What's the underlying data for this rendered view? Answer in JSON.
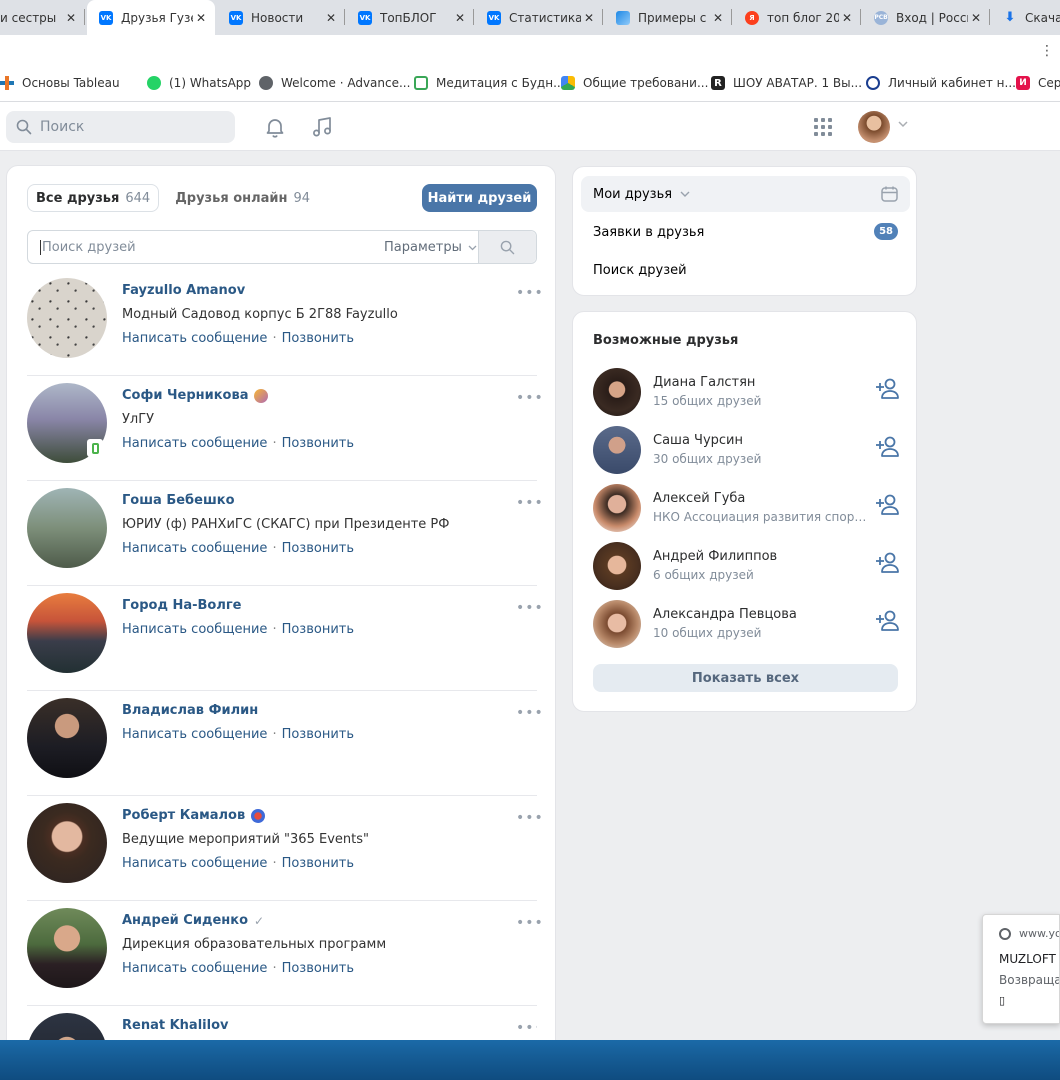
{
  "tabs": [
    {
      "title": "и сестры",
      "favicon": "generic",
      "active": false
    },
    {
      "title": "Друзья Гузе",
      "favicon": "vk",
      "active": true
    },
    {
      "title": "Новости",
      "favicon": "vk",
      "active": false
    },
    {
      "title": "ТопБЛОГ",
      "favicon": "vk",
      "active": false
    },
    {
      "title": "Статистика",
      "favicon": "vk",
      "active": false
    },
    {
      "title": "Примеры с",
      "favicon": "cloud",
      "active": false
    },
    {
      "title": "топ блог 20",
      "favicon": "yandex",
      "active": false
    },
    {
      "title": "Вход | Росси",
      "favicon": "rsv",
      "active": false
    },
    {
      "title": "Скачать",
      "favicon": "download",
      "active": false
    }
  ],
  "tab_close": "✕",
  "bookmarks": [
    {
      "label": "Основы Tableau",
      "icon": "tableau-icon",
      "color": "#e97627"
    },
    {
      "label": "(1) WhatsApp",
      "icon": "whatsapp-icon",
      "color": "#25d366"
    },
    {
      "label": "Welcome · Advance...",
      "icon": "globe-icon",
      "color": "#5f6368"
    },
    {
      "label": "Медитация с Будн...",
      "icon": "house-icon",
      "color": "#3aa757"
    },
    {
      "label": "Общие требовани...",
      "icon": "drive-icon",
      "color": "#fbbc04"
    },
    {
      "label": "ШОУ АВАТАР. 1 Вы...",
      "icon": "r-icon",
      "color": "#222222"
    },
    {
      "label": "Личный кабинет н...",
      "icon": "emblem-icon",
      "color": "#1a3d8f"
    },
    {
      "label": "Сер",
      "icon": "ivi-icon",
      "color": "#e4124b"
    }
  ],
  "header": {
    "search_placeholder": "Поиск",
    "icons": [
      "bell-icon",
      "music-icon",
      "apps-grid-icon"
    ]
  },
  "friends_page": {
    "tabs": [
      {
        "label": "Все друзья",
        "count": "644",
        "selected": true
      },
      {
        "label": "Друзья онлайн",
        "count": "94",
        "selected": false
      }
    ],
    "find_button": "Найти друзей",
    "search_placeholder": "Поиск друзей",
    "params_label": "Параметры",
    "action_message": "Написать сообщение",
    "action_call": "Позвонить",
    "more": "•••",
    "friends": [
      {
        "name": "Fayzullo Amanov",
        "subtitle": "Модный Садовод корпус Б 2Г88 Fayzullo",
        "badge": ""
      },
      {
        "name": "Софи Черникова",
        "subtitle": "УлГУ",
        "badge": "emoji",
        "mobile": true
      },
      {
        "name": "Гоша Бебешко",
        "subtitle": "ЮРИУ (ф) РАНХиГС (СКАГС) при Президенте РФ",
        "badge": ""
      },
      {
        "name": "Город На-Волге",
        "subtitle": "",
        "badge": ""
      },
      {
        "name": "Владислав Филин",
        "subtitle": "",
        "badge": ""
      },
      {
        "name": "Роберт Камалов",
        "subtitle": "Ведущие мероприятий \"365 Events\"",
        "badge": "emoji"
      },
      {
        "name": "Андрей Сиденко",
        "subtitle": "Дирекция образовательных программ",
        "badge": "check"
      },
      {
        "name": "Renat Khalilov",
        "subtitle": "",
        "badge": ""
      }
    ]
  },
  "sidebar": {
    "items": [
      {
        "label": "Мои друзья",
        "selected": true
      },
      {
        "label": "Заявки в друзья",
        "badge": "58"
      },
      {
        "label": "Поиск друзей"
      }
    ]
  },
  "possible_friends": {
    "title": "Возможные друзья",
    "people": [
      {
        "name": "Диана Галстян",
        "desc": "15 общих друзей"
      },
      {
        "name": "Саша Чурсин",
        "desc": "30 общих друзей"
      },
      {
        "name": "Алексей Губа",
        "desc": "НКО Ассоциация развития спорта и..."
      },
      {
        "name": "Андрей Филиппов",
        "desc": "6 общих друзей"
      },
      {
        "name": "Александра Певцова",
        "desc": "10 общих друзей"
      }
    ],
    "show_all": "Показать всех"
  },
  "notification": {
    "url": "www.yo",
    "title": "MUZLOFT",
    "desc": "Возвраща",
    "box": "▯"
  },
  "colors": {
    "vk_blue": "#4a76a8",
    "link": "#2a5885",
    "badge": "#5181b8",
    "page_bg": "#edeef0"
  }
}
